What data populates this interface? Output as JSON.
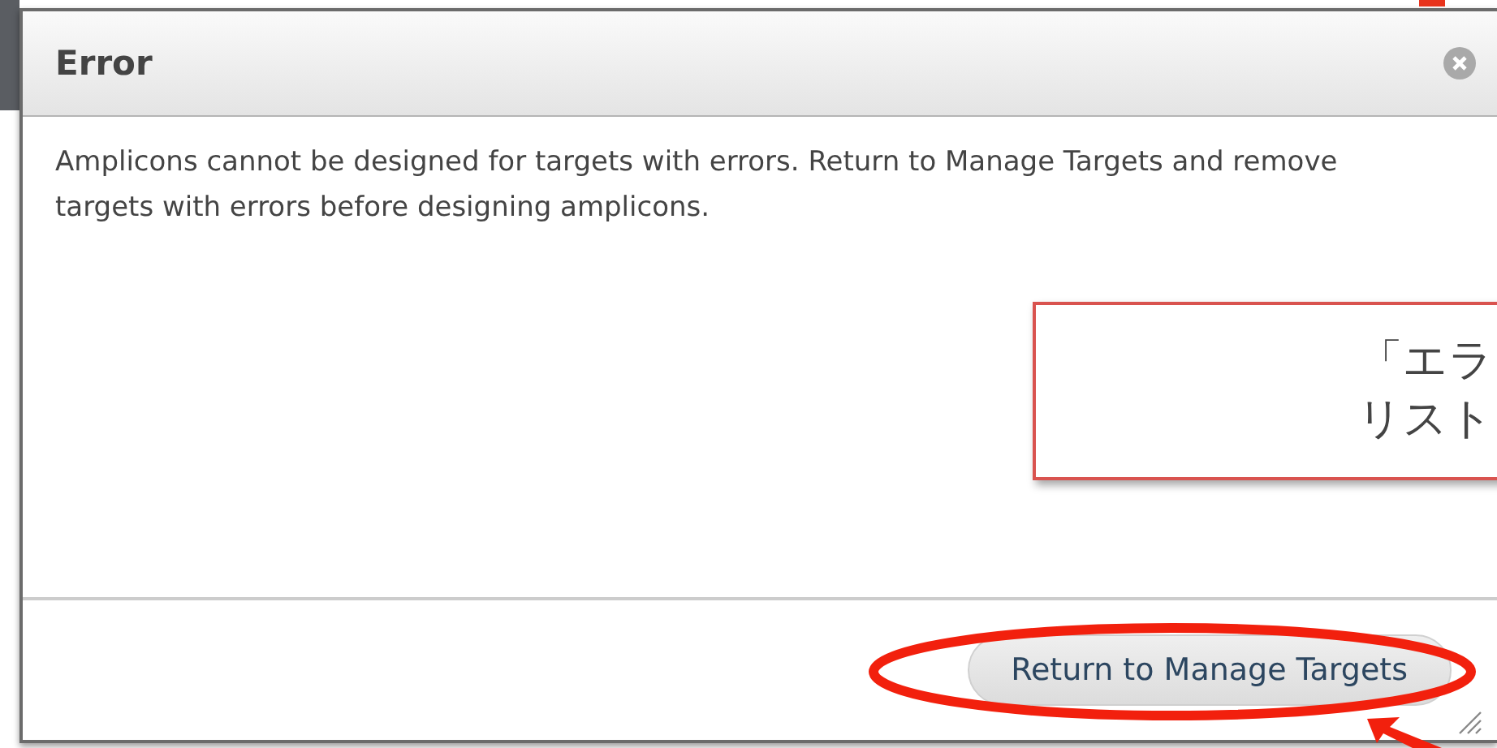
{
  "dialog": {
    "title": "Error",
    "message": "Amplicons cannot be designed for targets with errors. Return to Manage Targets and remove targets with errors before designing amplicons.",
    "button": "Return to Manage Targets"
  },
  "callout": {
    "lines": [
      "「エラ",
      "リスト"
    ]
  }
}
